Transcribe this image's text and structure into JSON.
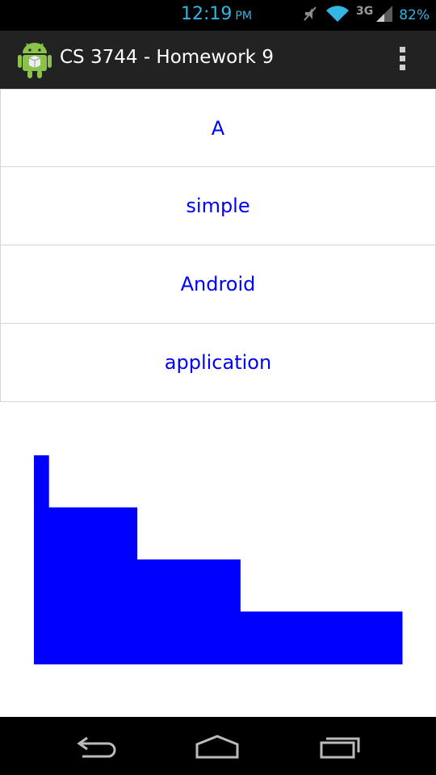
{
  "status_bar": {
    "time": "12:19",
    "time_suffix": "PM",
    "network": "3G",
    "battery": "82%",
    "icons": [
      "mute-icon",
      "wifi-icon",
      "signal-icon"
    ],
    "accent_color": "#33b5e5"
  },
  "action_bar": {
    "title": "CS 3744 - Homework 9",
    "icon": "android-app-icon",
    "overflow_icon": "overflow-menu-icon",
    "background": "#222222"
  },
  "list": {
    "items": [
      {
        "label": "A"
      },
      {
        "label": "simple"
      },
      {
        "label": "Android"
      },
      {
        "label": "application"
      }
    ],
    "text_color": "#0000ff"
  },
  "chart_data": {
    "type": "bar",
    "categories": [
      "A",
      "simple",
      "Android",
      "application"
    ],
    "values": [
      1,
      6,
      7,
      11
    ],
    "color": "#0000ff",
    "title": "",
    "xlabel": "",
    "ylabel": ""
  },
  "nav_bar": {
    "buttons": [
      "back-icon",
      "home-icon",
      "recent-apps-icon"
    ]
  }
}
